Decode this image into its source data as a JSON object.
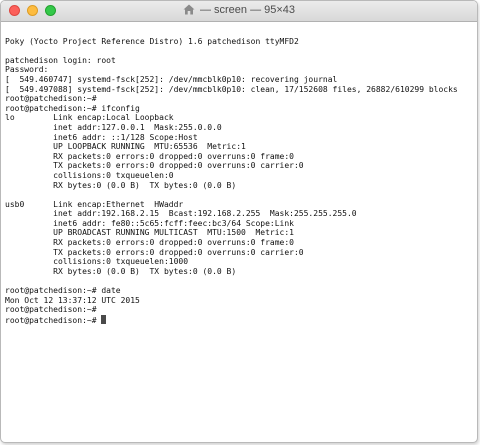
{
  "window": {
    "title": "— screen — 95×43",
    "colors": {
      "close": "#fc605b",
      "minimize": "#fdbc40",
      "maximize": "#34c84a"
    }
  },
  "terminal": {
    "lines": [
      "",
      "Poky (Yocto Project Reference Distro) 1.6 patchedison ttyMFD2",
      "",
      "patchedison login: root",
      "Password:",
      "[  549.460747] systemd-fsck[252]: /dev/mmcblk0p10: recovering journal",
      "[  549.497088] systemd-fsck[252]: /dev/mmcblk0p10: clean, 17/152608 files, 26882/610299 blocks",
      "root@patchedison:~#",
      "root@patchedison:~# ifconfig",
      "lo        Link encap:Local Loopback",
      "          inet addr:127.0.0.1  Mask:255.0.0.0",
      "          inet6 addr: ::1/128 Scope:Host",
      "          UP LOOPBACK RUNNING  MTU:65536  Metric:1",
      "          RX packets:0 errors:0 dropped:0 overruns:0 frame:0",
      "          TX packets:0 errors:0 dropped:0 overruns:0 carrier:0",
      "          collisions:0 txqueuelen:0",
      "          RX bytes:0 (0.0 B)  TX bytes:0 (0.0 B)",
      "",
      "usb0      Link encap:Ethernet  HWaddr",
      "          inet addr:192.168.2.15  Bcast:192.168.2.255  Mask:255.255.255.0",
      "          inet6 addr: fe80::5c65:fcff:feec:bc3/64 Scope:Link",
      "          UP BROADCAST RUNNING MULTICAST  MTU:1500  Metric:1",
      "          RX packets:0 errors:0 dropped:0 overruns:0 frame:0",
      "          TX packets:0 errors:0 dropped:0 overruns:0 carrier:0",
      "          collisions:0 txqueuelen:1000",
      "          RX bytes:0 (0.0 B)  TX bytes:0 (0.0 B)",
      "",
      "root@patchedison:~# date",
      "Mon Oct 12 13:37:12 UTC 2015",
      "root@patchedison:~#"
    ],
    "prompt": "root@patchedison:~# "
  }
}
